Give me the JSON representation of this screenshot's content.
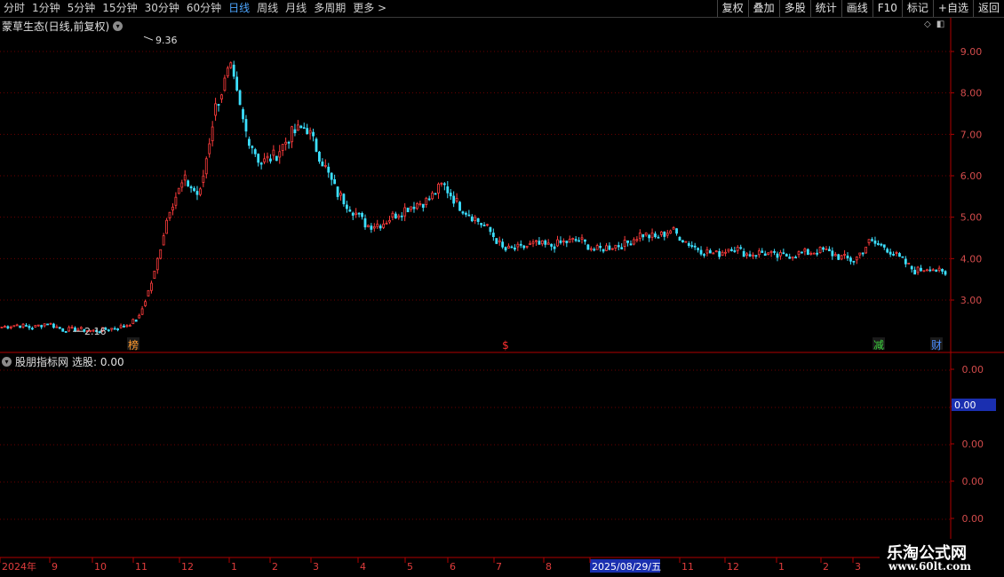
{
  "toolbar": {
    "timeframes": [
      "分时",
      "1分钟",
      "5分钟",
      "15分钟",
      "30分钟",
      "60分钟",
      "日线",
      "周线",
      "月线",
      "多周期",
      "更多 >"
    ],
    "active_timeframe": "日线",
    "right_tools": [
      "复权",
      "叠加",
      "多股",
      "统计",
      "画线",
      "F10",
      "标记",
      "+自选",
      "返回"
    ]
  },
  "main_title": "蒙草生态(日线,前复权)",
  "indicator_title": "股朋指标网",
  "indicator_value_text": "选股: 0.00",
  "colors": {
    "up": "#ff3c3c",
    "down": "#3ce0ff",
    "grid": "#6b0000",
    "axis": "#b00000",
    "label": "#d24b4b",
    "time_label": "#e03c3c"
  },
  "watermark": {
    "line1": "乐淘公式网",
    "line2": "www.60lt.com"
  },
  "chart_data": [
    {
      "type": "candlestick",
      "title": "蒙草生态(日线,前复权)",
      "y_ticks": [
        "9.00",
        "8.00",
        "7.00",
        "6.00",
        "5.00",
        "4.00",
        "3.00"
      ],
      "ylim": [
        2.0,
        9.75
      ],
      "annotations": [
        {
          "text": "9.36",
          "value": 9.36,
          "kind": "high"
        },
        {
          "text": "2.16",
          "value": 2.16,
          "kind": "low"
        }
      ],
      "markers": [
        {
          "text": "榜",
          "month_index": 2
        },
        {
          "text": "$",
          "month_index": 10
        },
        {
          "text": "减",
          "month_index": 19
        },
        {
          "text": "财",
          "month_index": 20
        }
      ],
      "x_labels": [
        "2024年",
        "9",
        "10",
        "11",
        "12",
        "1",
        "2",
        "3",
        "4",
        "5",
        "6",
        "7",
        "8",
        "2025/08/29/五",
        "11",
        "12",
        "1",
        "2",
        "3"
      ],
      "highlighted_label": "2025/08/29/五",
      "close_path": [
        2.35,
        2.4,
        2.33,
        2.45,
        2.28,
        2.3,
        2.25,
        2.3,
        2.36,
        2.55,
        3.6,
        5.2,
        5.9,
        5.5,
        7.6,
        8.6,
        7.1,
        6.3,
        6.5,
        7.0,
        7.2,
        6.4,
        5.6,
        5.2,
        4.8,
        4.85,
        5.1,
        5.3,
        5.4,
        5.8,
        5.3,
        5.0,
        4.7,
        4.2,
        4.25,
        4.35,
        4.3,
        4.4,
        4.45,
        4.2,
        4.3,
        4.35,
        4.6,
        4.5,
        4.7,
        4.4,
        4.2,
        4.1,
        4.3,
        4.1,
        4.15,
        4.05,
        4.1,
        4.15,
        4.2,
        4.05,
        3.95,
        4.4,
        4.3,
        4.0,
        3.7,
        3.8,
        3.6
      ],
      "candle_count": 310
    },
    {
      "type": "line",
      "title": "股朋指标网",
      "series": [
        {
          "name": "选股",
          "value": 0.0
        }
      ],
      "y_ticks": [
        "0.00",
        "0.00",
        "0.00",
        "0.00",
        "0.00"
      ],
      "current_value": "0.00"
    }
  ]
}
